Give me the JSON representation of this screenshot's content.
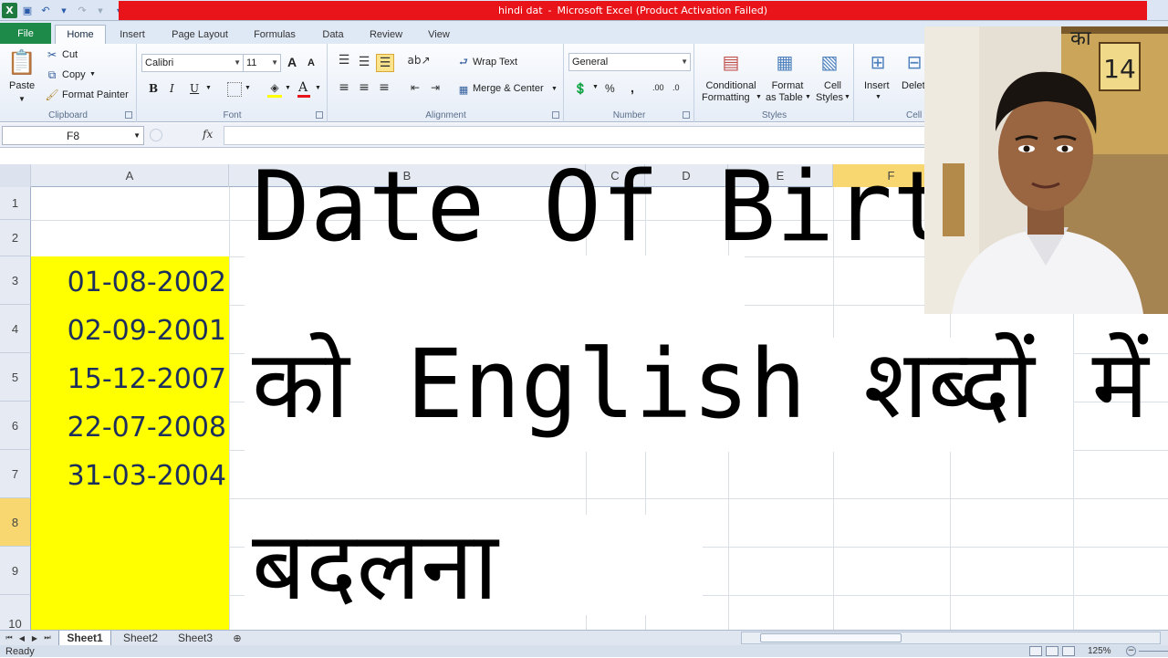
{
  "window": {
    "title_parts": [
      "hindi dat",
      "-",
      "Microsoft Excel (Product Activation Failed)"
    ],
    "accent_color": "#e8141a"
  },
  "qat": {
    "logo": "X",
    "save_icon": "floppy-icon",
    "undo_icon": "undo-icon",
    "redo_icon": "redo-icon"
  },
  "tabs": {
    "file": "File",
    "items": [
      "Home",
      "Insert",
      "Page Layout",
      "Formulas",
      "Data",
      "Review",
      "View"
    ],
    "active": "Home"
  },
  "ribbon": {
    "clipboard": {
      "label": "Clipboard",
      "paste": "Paste",
      "cut": "Cut",
      "copy": "Copy",
      "format_painter": "Format Painter"
    },
    "font": {
      "label": "Font",
      "name": "Calibri",
      "size": "11",
      "bold": "B",
      "italic": "I",
      "underline": "U",
      "grow": "A",
      "shrink": "A"
    },
    "alignment": {
      "label": "Alignment",
      "wrap_text": "Wrap Text",
      "merge_center": "Merge & Center"
    },
    "number": {
      "label": "Number",
      "format": "General",
      "percent": "%",
      "comma": ",",
      "inc_dec": ".00",
      "dec_dec": ".0"
    },
    "styles": {
      "label": "Styles",
      "conditional": [
        "Conditional",
        "Formatting"
      ],
      "format_table": [
        "Format",
        "as Table"
      ],
      "cell_styles": [
        "Cell",
        "Styles"
      ]
    },
    "cells": {
      "label": "Cell",
      "insert": "Insert",
      "delete": "Delet"
    }
  },
  "formula_bar": {
    "name_box": "F8",
    "fx": "fx",
    "value": ""
  },
  "grid": {
    "columns": [
      "A",
      "B",
      "C",
      "D",
      "E",
      "F"
    ],
    "selected_column": "F",
    "rows": [
      "1",
      "2",
      "3",
      "4",
      "5",
      "6",
      "7",
      "8",
      "9",
      "10"
    ],
    "selected_row": "8",
    "dates": [
      "01-08-2002",
      "02-09-2001",
      "15-12-2007",
      "22-07-2008",
      "31-03-2004"
    ],
    "highlight_color": "#ffff00"
  },
  "overlay": {
    "line1": "Date Of Birth",
    "line2": "को English शब्दों में",
    "line3": "बदलना"
  },
  "sheets": {
    "tabs": [
      "Sheet1",
      "Sheet2",
      "Sheet3"
    ],
    "active": "Sheet1"
  },
  "status": {
    "mode": "Ready",
    "zoom": "125%"
  }
}
